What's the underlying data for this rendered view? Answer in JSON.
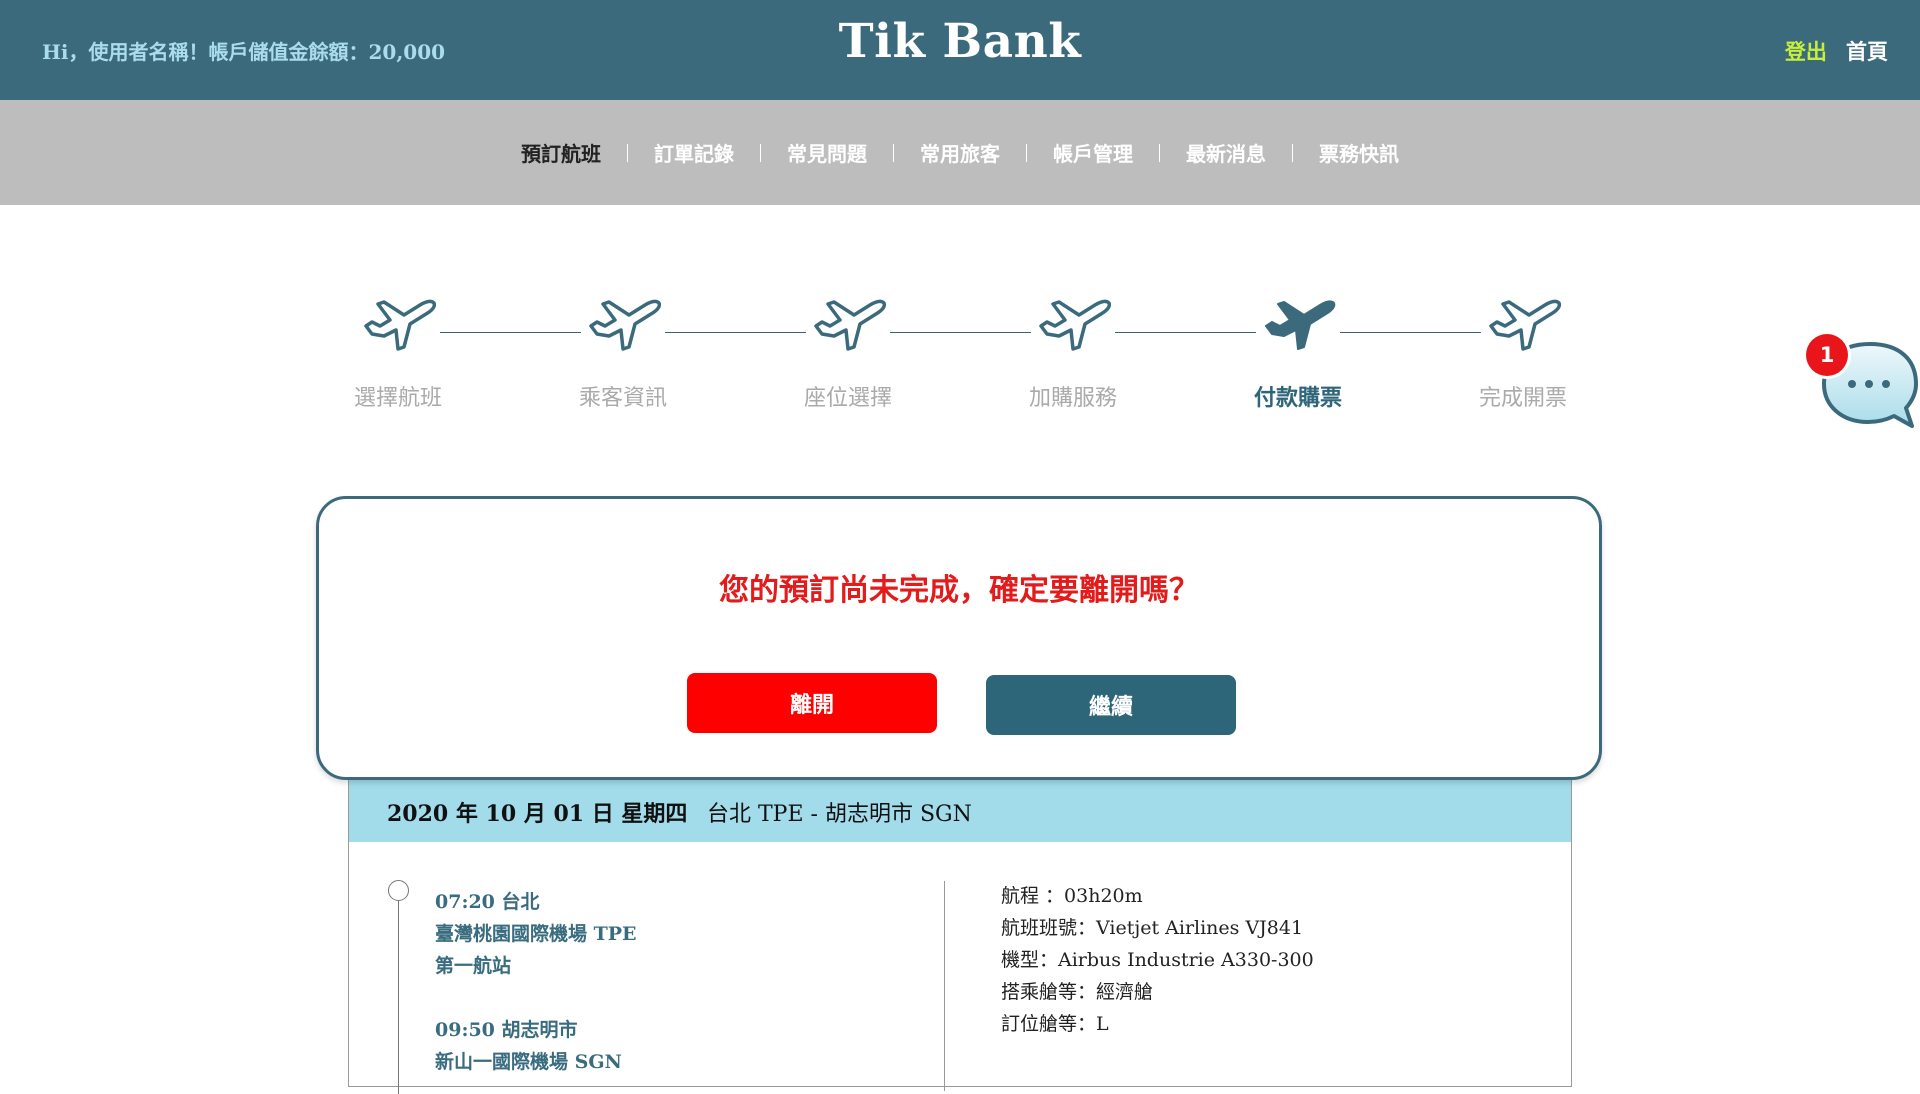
{
  "header": {
    "greeting": "Hi，使用者名稱！帳戶儲值金餘額：20,000",
    "brand": "Tik Bank",
    "logout": "登出",
    "home": "首頁"
  },
  "nav": {
    "items": [
      {
        "label": "預訂航班",
        "active": true
      },
      {
        "label": "訂單記錄"
      },
      {
        "label": "常見問題"
      },
      {
        "label": "常用旅客"
      },
      {
        "label": "帳戶管理"
      },
      {
        "label": "最新消息"
      },
      {
        "label": "票務快訊"
      }
    ]
  },
  "steps": {
    "items": [
      {
        "label": "選擇航班"
      },
      {
        "label": "乘客資訊"
      },
      {
        "label": "座位選擇"
      },
      {
        "label": "加購服務"
      },
      {
        "label": "付款購票",
        "active": true
      },
      {
        "label": "完成開票"
      }
    ]
  },
  "chat": {
    "badge": "1",
    "icon": "chat-bubble-icon"
  },
  "dialog": {
    "message": "您的預訂尚未完成，確定要離開嗎？",
    "leave_label": "離開",
    "continue_label": "繼續"
  },
  "flight": {
    "date": "2020 年 10 月 01 日 星期四",
    "route": "台北 TPE - 胡志明市 SGN",
    "departure": {
      "time_city": "07:20 台北",
      "airport": "臺灣桃園國際機場 TPE",
      "terminal": "第一航站"
    },
    "arrival": {
      "time_city": "09:50 胡志明市",
      "airport": "新山一國際機場 SGN"
    },
    "details": {
      "duration": "航程 ：03h20m",
      "flight_no": "航班班號：Vietjet Airlines VJ841",
      "aircraft": "機型：Airbus Industrie A330-300",
      "cabin": "搭乘艙等：經濟艙",
      "booking_class": "訂位艙等：L"
    }
  },
  "colors": {
    "header_bg": "#3b6a7c",
    "nav_bg": "#bdbdbd",
    "accent": "#2d6579",
    "alert": "#e31b1b",
    "leave_button": "#ff0000",
    "card_header": "#a2dbe9"
  }
}
